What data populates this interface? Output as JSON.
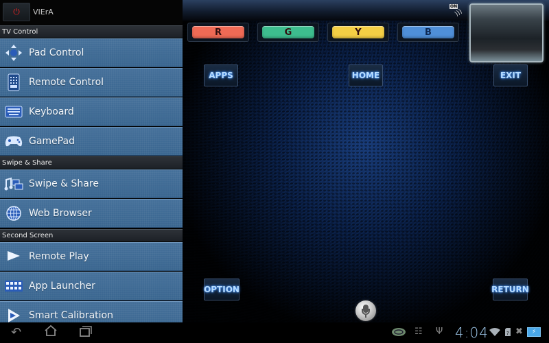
{
  "app": {
    "name": "VIErA",
    "power_icon": "power-icon"
  },
  "sidebar": {
    "sections": [
      {
        "title": "TV Control",
        "items": [
          {
            "label": "Pad Control",
            "icon": "dpad-icon"
          },
          {
            "label": "Remote Control",
            "icon": "remote-icon"
          },
          {
            "label": "Keyboard",
            "icon": "keyboard-icon"
          },
          {
            "label": "GamePad",
            "icon": "gamepad-icon"
          }
        ]
      },
      {
        "title": "Swipe & Share",
        "items": [
          {
            "label": "Swipe & Share",
            "icon": "media-share-icon"
          },
          {
            "label": "Web Browser",
            "icon": "globe-icon"
          }
        ]
      },
      {
        "title": "Second Screen",
        "items": [
          {
            "label": "Remote Play",
            "icon": "play-icon"
          },
          {
            "label": "App Launcher",
            "icon": "app-grid-icon"
          },
          {
            "label": "Smart Calibration",
            "icon": "calibration-icon"
          }
        ]
      }
    ]
  },
  "remote": {
    "tv_status": "ON",
    "color_buttons": [
      {
        "label": "R",
        "color": "#ef6a55"
      },
      {
        "label": "G",
        "color": "#3dbd8e"
      },
      {
        "label": "Y",
        "color": "#f4cf45"
      },
      {
        "label": "B",
        "color": "#4f8fd8"
      }
    ],
    "buttons": {
      "apps": "APPS",
      "home": "HOME",
      "exit": "EXIT",
      "option": "OPTION",
      "return": "RETURN"
    },
    "mic_icon": "microphone-icon"
  },
  "system_bar": {
    "time": "4:04",
    "nav": [
      "back-icon",
      "home-icon",
      "recent-apps-icon"
    ],
    "status_icons": [
      "app-notification-icon",
      "android-debug-icon",
      "usb-icon",
      "wifi-icon",
      "sd-card-icon",
      "mute-icon",
      "battery-charging-icon"
    ]
  }
}
